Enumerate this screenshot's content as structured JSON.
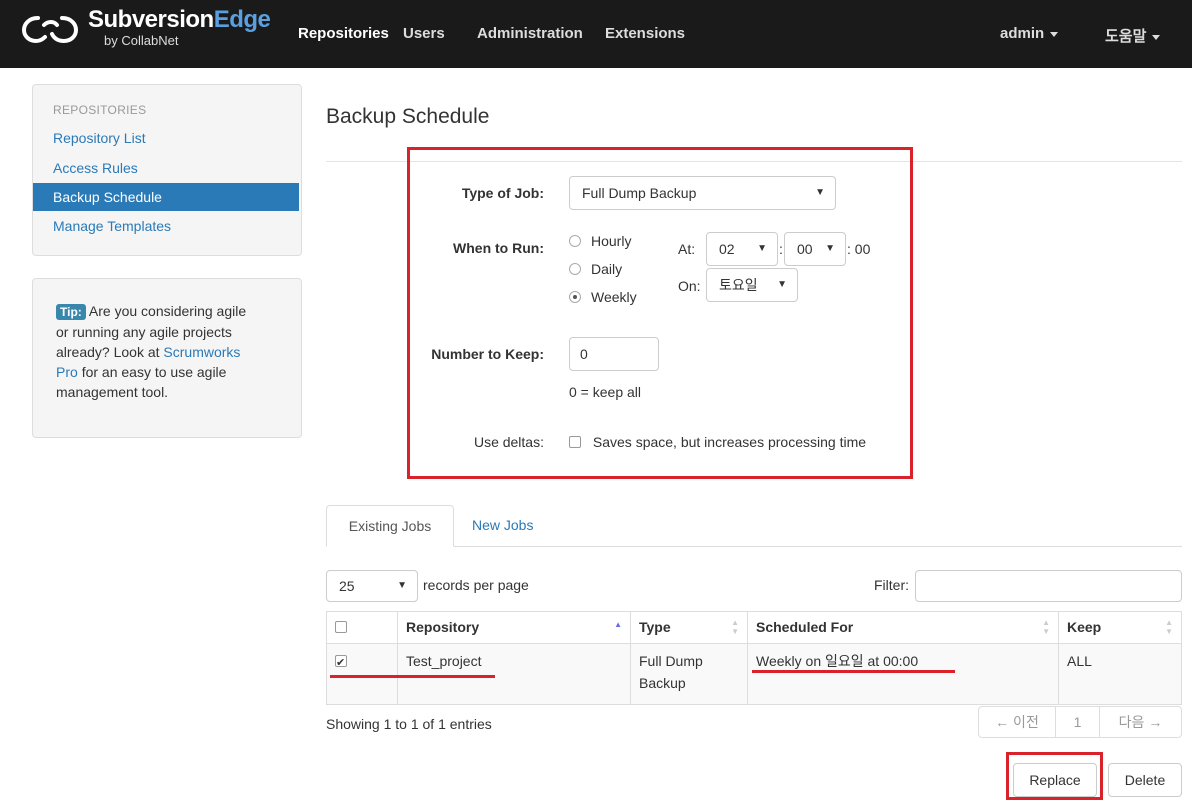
{
  "nav": {
    "brand_title_main": "Subversion",
    "brand_title_accent": "Edge",
    "brand_sub": "by CollabNet",
    "items": [
      "Repositories",
      "Users",
      "Administration",
      "Extensions"
    ],
    "user": "admin",
    "help": "도움말"
  },
  "sidebar": {
    "header": "REPOSITORIES",
    "links": [
      "Repository List",
      "Access Rules",
      "Backup Schedule",
      "Manage Templates"
    ],
    "tip_label": "Tip:",
    "tip_text_1": "Are you considering agile",
    "tip_text_2": "or running any agile projects",
    "tip_text_3": "already? Look at",
    "tip_link_1": "Scrumworks",
    "tip_link_2": "Pro",
    "tip_text_4": "for an easy to use agile",
    "tip_text_5": "management tool."
  },
  "page": {
    "title": "Backup Schedule"
  },
  "form": {
    "type_label": "Type of Job:",
    "type_value": "Full Dump Backup",
    "when_label": "When to Run:",
    "radios": [
      "Hourly",
      "Daily",
      "Weekly"
    ],
    "selected_radio": "Weekly",
    "at_label": "At:",
    "hour": "02",
    "minute": "00",
    "seconds": ": 00",
    "on_label": "On:",
    "day": "토요일",
    "keep_label": "Number to Keep:",
    "keep_value": "0",
    "keep_help": "0 = keep all",
    "deltas_label": "Use deltas:",
    "deltas_text": "Saves space, but increases processing time"
  },
  "tabs": [
    "Existing Jobs",
    "New Jobs"
  ],
  "table": {
    "records_value": "25",
    "records_label": "records per page",
    "filter_label": "Filter:",
    "headers": [
      "Repository",
      "Type",
      "Scheduled For",
      "Keep"
    ],
    "rows": [
      {
        "repository": "Test_project",
        "type_1": "Full Dump",
        "type_2": "Backup",
        "scheduled": "Weekly on 일요일 at 00:00",
        "keep": "ALL"
      }
    ],
    "info": "Showing 1 to 1 of 1 entries",
    "prev": "← 이전",
    "page": "1",
    "next": "다음 →"
  },
  "buttons": {
    "replace": "Replace",
    "delete": "Delete"
  },
  "colors": {
    "accent": "#2a7ab8",
    "highlight": "#d8232a",
    "navbar": "#1a1a1a"
  }
}
